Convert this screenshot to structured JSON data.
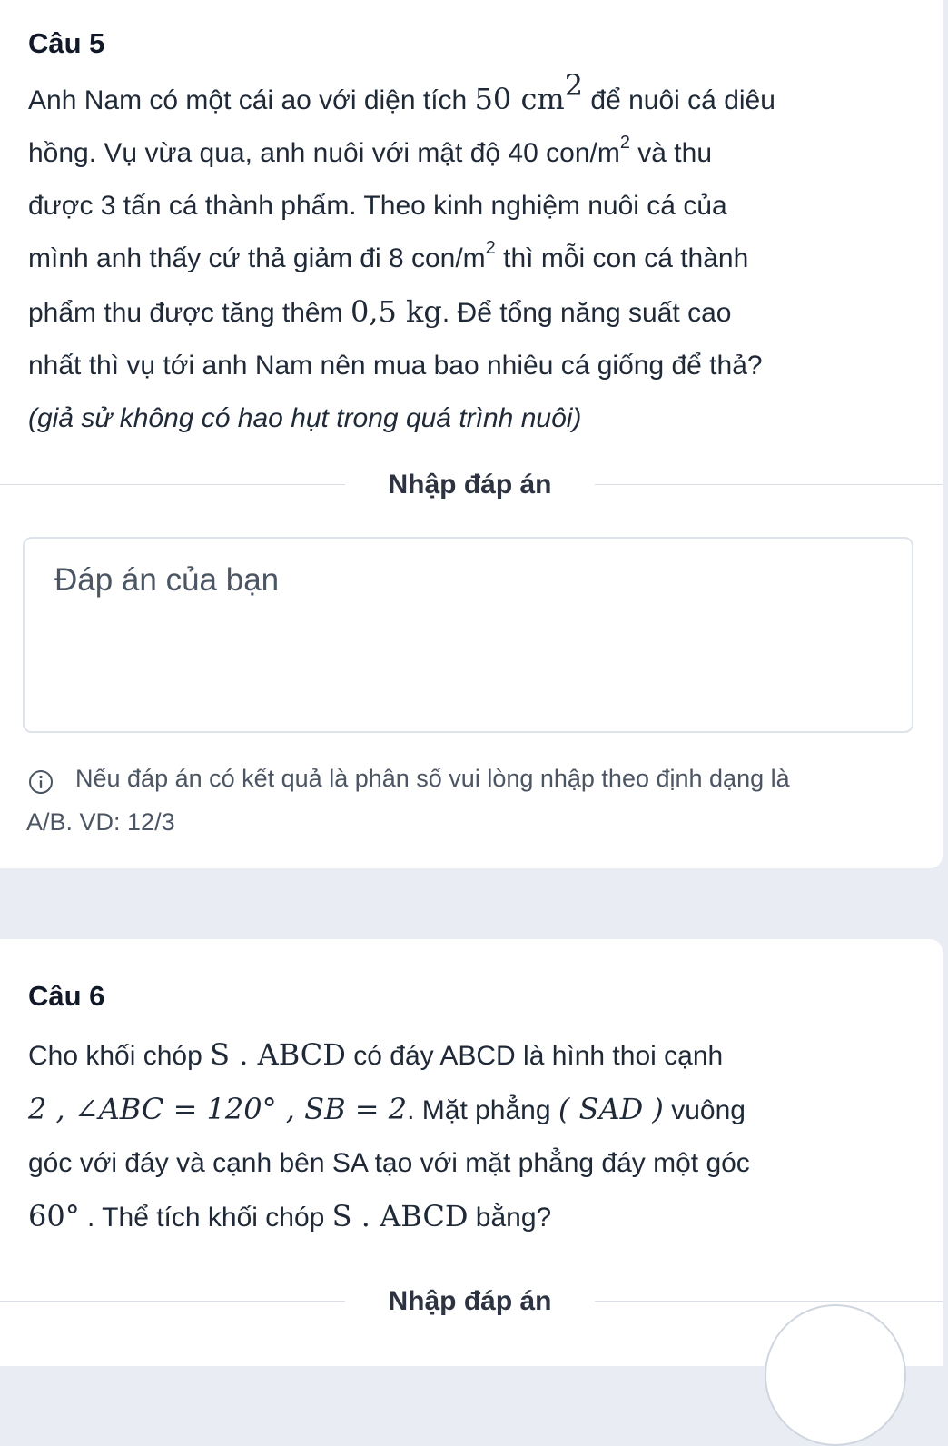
{
  "q5": {
    "title": "Câu 5",
    "line1": [
      "Anh Nam có một cái ao với diện tích ",
      "50 cm",
      "2",
      " để nuôi cá diêu"
    ],
    "line2": [
      "hồng. Vụ vừa qua, anh nuôi với mật độ 40 con/m",
      "2",
      " và thu"
    ],
    "line3": "được 3 tấn cá thành phẩm. Theo kinh nghiệm nuôi cá của",
    "line4": [
      "mình anh thấy cứ thả giảm đi 8 con/m",
      "2",
      " thì mỗi con cá thành"
    ],
    "line5": [
      "phẩm thu được tăng thêm ",
      "0,5 kg",
      ". Để tổng năng suất cao"
    ],
    "line6": "nhất thì vụ tới anh Nam nên mua bao nhiêu cá giống để thả?",
    "line7": "(giả sử không có hao hụt trong quá trình nuôi)",
    "divider_label": "Nhập đáp án",
    "answer_placeholder": "Đáp án của bạn",
    "answer_value": "",
    "hint_line1": "Nếu đáp án có kết quả là phân số vui lòng nhập theo định dạng là",
    "hint_line2": "A/B. VD: 12/3",
    "info_icon": "info-circle-icon"
  },
  "q6": {
    "title": "Câu 6",
    "line1": [
      "Cho khối chóp ",
      "S . ABCD",
      " có đáy ABCD là hình thoi cạnh"
    ],
    "line2": [
      "2 , ∠ABC = 120° , SB = 2",
      ". Mặt phẳng ",
      "( SAD )",
      " vuông"
    ],
    "line3": "góc với đáy và cạnh bên SA tạo với mặt phẳng đáy một góc",
    "line4": [
      "60°",
      " . Thể tích khối chóp ",
      "S . ABCD",
      " bằng?"
    ],
    "divider_label": "Nhập đáp án"
  },
  "colors": {
    "page_bg": "#e9edf3",
    "card_bg": "#ffffff",
    "text": "#1f2937",
    "muted": "#4b5563",
    "border": "#dde3ea"
  }
}
